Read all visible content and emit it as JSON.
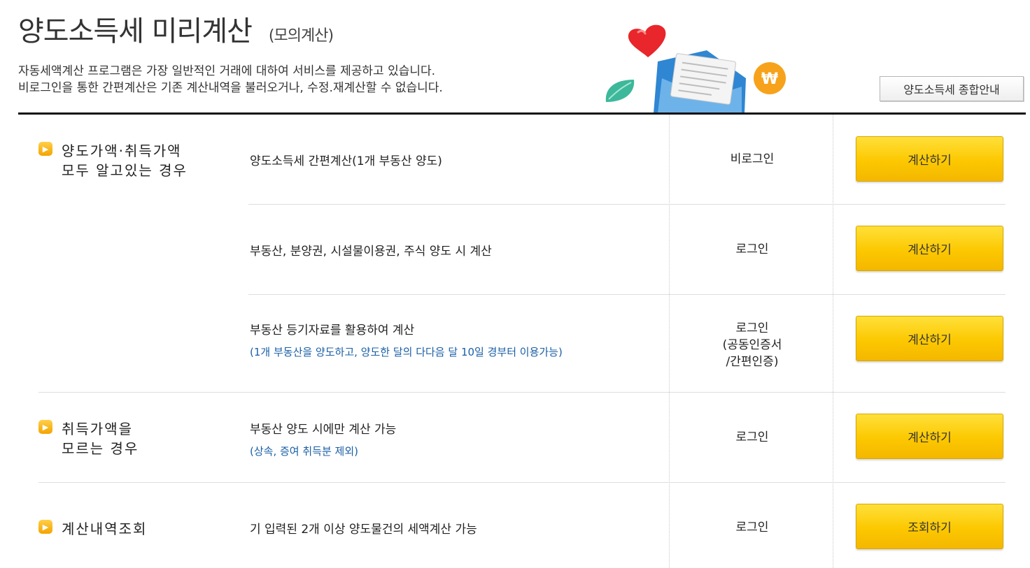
{
  "header": {
    "title": "양도소득세 미리계산",
    "subtitle": "(모의계산)",
    "desc_line1": "자동세액계산 프로그램은 가장 일반적인 거래에 대하여 서비스를 제공하고 있습니다.",
    "desc_line2": "비로그인을 통한 간편계산은 기존 계산내역을 불러오거나, 수정.재계산할 수 없습니다.",
    "guide_button": "양도소득세 종합안내"
  },
  "categories": {
    "known": "양도가액·취득가액\n모두 알고있는 경우",
    "unknown": "취득가액을\n모르는 경우",
    "history": "계산내역조회"
  },
  "rows": [
    {
      "desc": "양도소득세 간편계산(1개 부동산 양도)",
      "note": "",
      "login": "비로그인",
      "button": "계산하기"
    },
    {
      "desc": "부동산, 분양권, 시설물이용권, 주식 양도 시 계산",
      "note": "",
      "login": "로그인",
      "button": "계산하기"
    },
    {
      "desc": "부동산 등기자료를 활용하여 계산",
      "note": "(1개 부동산을 양도하고, 양도한 달의 다다음 달 10일 경부터 이용가능)",
      "login": "로그인\n(공동인증서\n/간편인증)",
      "button": "계산하기"
    },
    {
      "desc": "부동산 양도 시에만 계산 가능",
      "note": "(상속, 증여 취득분 제외)",
      "login": "로그인",
      "button": "계산하기"
    },
    {
      "desc": "기 입력된 2개 이상 양도물건의 세액계산 가능",
      "note": "",
      "login": "로그인",
      "button": "조회하기"
    }
  ],
  "colors": {
    "button_yellow": "#fcc800",
    "note_blue": "#1a5fa6",
    "bullet_orange": "#f5a800"
  }
}
